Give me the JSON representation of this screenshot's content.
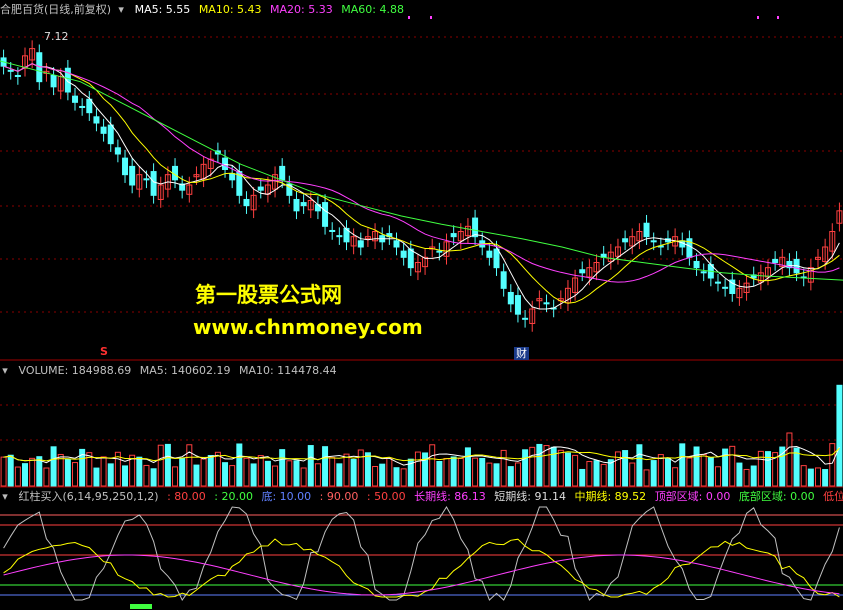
{
  "main": {
    "title": "合肥百货(日线,前复权)",
    "ma5": "MA5: 5.55",
    "ma10": "MA10: 5.43",
    "ma20": "MA20: 5.33",
    "ma60": "MA60: 4.88",
    "high_label": "7.12",
    "marker_s": "S",
    "marker_cai": "财"
  },
  "volume": {
    "title": "VOLUME: 184988.69",
    "ma5": "MA5: 140602.19",
    "ma10": "MA10: 114478.44"
  },
  "indicator": {
    "title": "红柱买入(6,14,95,250,1,2)",
    "v1": ": 80.00",
    "v2": ": 20.00",
    "l1": "底: 10.00",
    "v3": ": 90.00",
    "v4": ": 50.00",
    "l2": "长期线: 86.13",
    "l3": "短期线: 91.14",
    "l4": "中期线: 89.52",
    "l5": "顶部区域: 0.00",
    "l6": "底部区域: 0.00",
    "l7": "低位金叉"
  },
  "watermark": {
    "line1": "第一股票公式网",
    "line2": "www.chnmoney.com"
  },
  "colors": {
    "up": "#ff4040",
    "down": "#54ffff",
    "ma5": "#ffffff",
    "ma10": "#ffff00",
    "ma20": "#ff40ff",
    "ma60": "#40ff40"
  },
  "chart_data": [
    {
      "type": "candlestick",
      "title": "合肥百货(日线,前复权)",
      "series_labels": [
        "MA5",
        "MA10",
        "MA20",
        "MA60"
      ],
      "last_values": {
        "MA5": 5.55,
        "MA10": 5.43,
        "MA20": 5.33,
        "MA60": 4.88
      },
      "annotated_high": 7.12,
      "close": [
        6.95,
        6.9,
        6.85,
        7.05,
        7.12,
        6.8,
        6.9,
        6.75,
        6.85,
        6.7,
        6.6,
        6.55,
        6.5,
        6.4,
        6.3,
        6.2,
        6.1,
        5.9,
        5.8,
        5.9,
        5.85,
        5.7,
        5.8,
        5.9,
        5.85,
        5.75,
        5.8,
        5.9,
        6.0,
        6.05,
        6.1,
        5.95,
        5.85,
        5.7,
        5.6,
        5.7,
        5.75,
        5.8,
        5.9,
        5.85,
        5.7,
        5.55,
        5.6,
        5.65,
        5.55,
        5.4,
        5.35,
        5.3,
        5.25,
        5.3,
        5.2,
        5.3,
        5.35,
        5.25,
        5.3,
        5.2,
        5.1,
        5.0,
        5.05,
        5.1,
        5.2,
        5.15,
        5.25,
        5.3,
        5.35,
        5.4,
        5.3,
        5.2,
        5.1,
        5.0,
        4.8,
        4.65,
        4.55,
        4.5,
        4.6,
        4.7,
        4.65,
        4.6,
        4.7,
        4.8,
        4.9,
        4.95,
        5.0,
        5.05,
        5.1,
        5.15,
        5.2,
        5.25,
        5.3,
        5.35,
        5.3,
        5.25,
        5.2,
        5.25,
        5.3,
        5.2,
        5.1,
        5.0,
        4.95,
        4.9,
        4.85,
        4.8,
        4.75,
        4.8,
        4.85,
        4.9,
        4.95,
        5.0,
        5.05,
        5.1,
        5.0,
        4.95,
        4.9,
        5.0,
        5.1,
        5.2,
        5.35,
        5.55
      ],
      "ma60_approx": [
        7.0,
        6.9,
        6.8,
        6.6,
        6.4,
        6.2,
        6.0,
        5.85,
        5.7,
        5.6,
        5.5,
        5.42,
        5.35,
        5.28,
        5.2,
        5.1,
        5.05,
        5.0,
        4.95,
        4.92,
        4.9,
        4.88
      ]
    },
    {
      "type": "bar",
      "title": "VOLUME",
      "last_value": 184988.69,
      "ma5": 140602.19,
      "ma10": 114478.44
    },
    {
      "type": "line",
      "title": "红柱买入(6,14,95,250,1,2)",
      "levels": [
        80,
        20,
        10,
        90,
        50
      ],
      "long_line": 86.13,
      "short_line": 91.14,
      "mid_line": 89.52,
      "top_zone": 0.0,
      "bottom_zone": 0.0
    }
  ]
}
